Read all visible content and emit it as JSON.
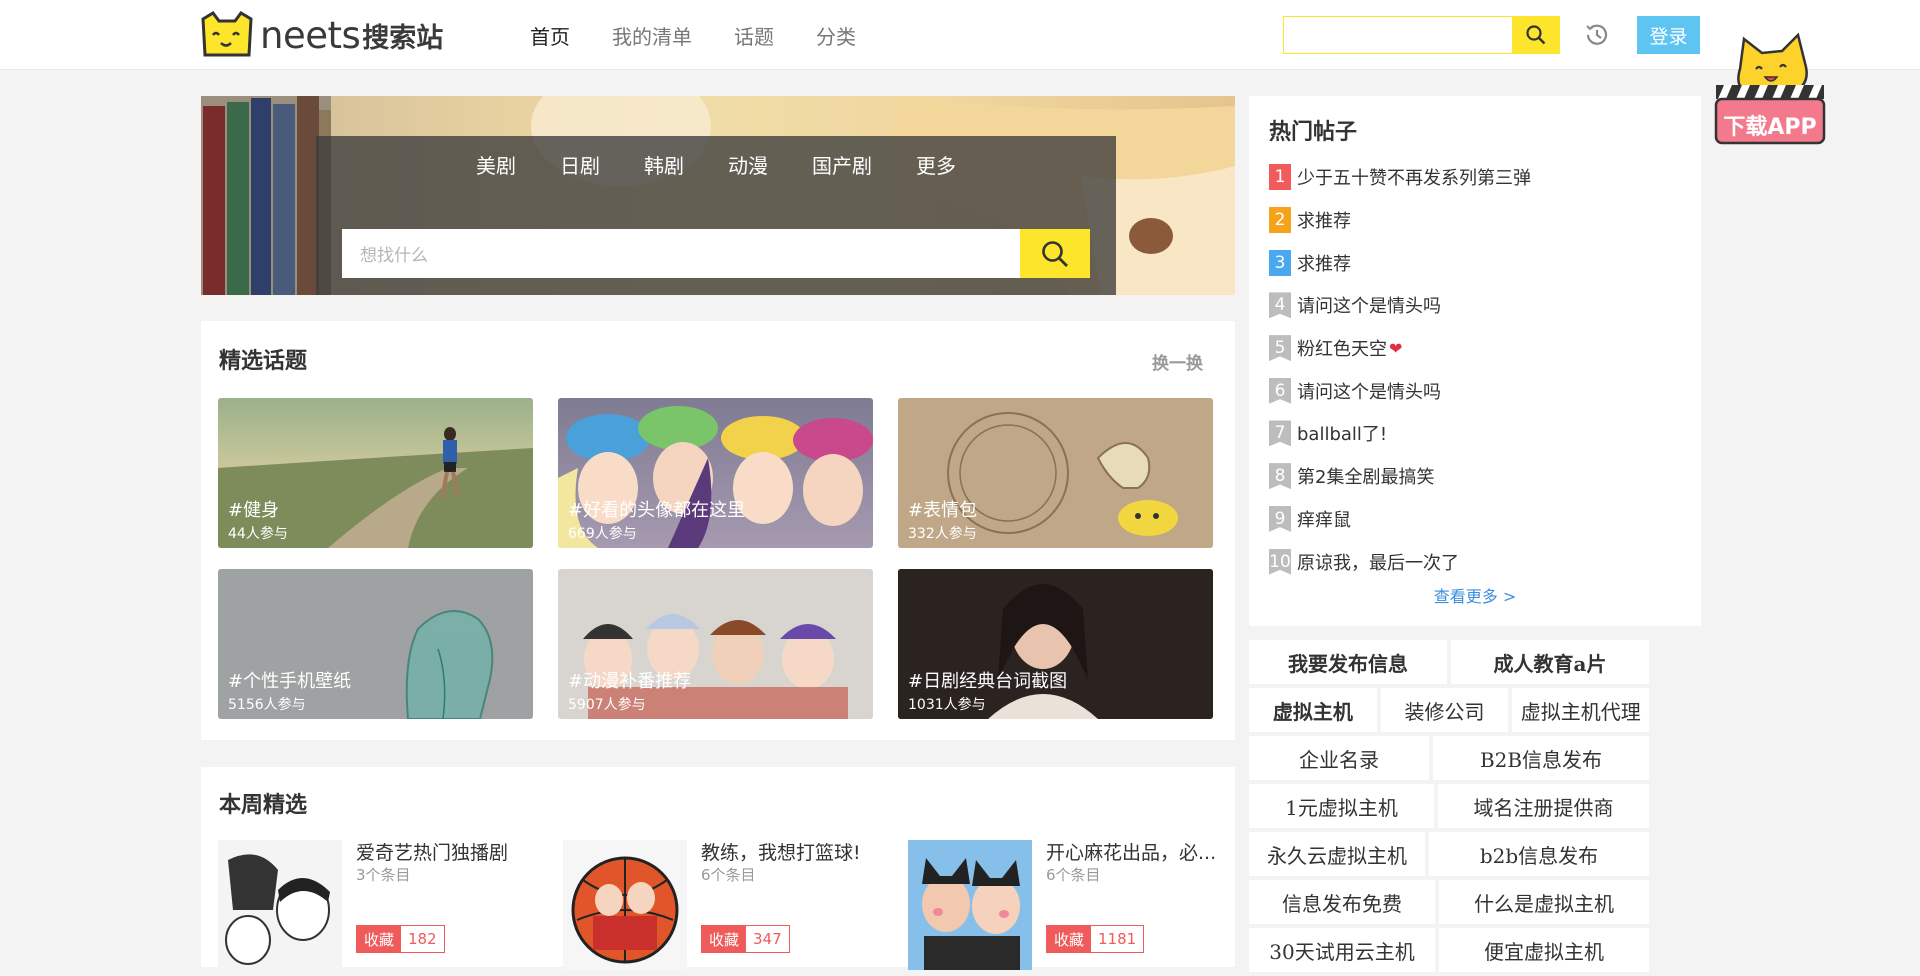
{
  "header": {
    "logo_text": "neets",
    "logo_sub": "搜索站",
    "nav": [
      "首页",
      "我的清单",
      "话题",
      "分类"
    ],
    "search_value": "",
    "login_label": "登录",
    "app_badge_label": "下载APP"
  },
  "banner": {
    "tabs": [
      "美剧",
      "日剧",
      "韩剧",
      "动漫",
      "国产剧",
      "更多"
    ],
    "search_placeholder": "想找什么"
  },
  "topics": {
    "title": "精选话题",
    "refresh_label": "换一换",
    "items": [
      {
        "name": "#健身",
        "count": "44人参与"
      },
      {
        "name": "#好看的头像都在这里",
        "count": "669人参与"
      },
      {
        "name": "#表情包",
        "count": "332人参与"
      },
      {
        "name": "#个性手机壁纸",
        "count": "5156人参与"
      },
      {
        "name": "#动漫补番推荐",
        "count": "5907人参与"
      },
      {
        "name": "#日剧经典台词截图",
        "count": "1031人参与"
      }
    ]
  },
  "weekly": {
    "title": "本周精选",
    "items": [
      {
        "name": "爱奇艺热门独播剧",
        "count": "3个条目",
        "fav_label": "收藏",
        "fav_count": "182"
      },
      {
        "name": "教练，我想打篮球!",
        "count": "6个条目",
        "fav_label": "收藏",
        "fav_count": "347"
      },
      {
        "name": "开心麻花出品，必...",
        "count": "6个条目",
        "fav_label": "收藏",
        "fav_count": "1181"
      }
    ]
  },
  "hot": {
    "title": "热门帖子",
    "items": [
      {
        "rank": "1",
        "text": "少于五十赞不再发系列第三弹",
        "color": "#f15b5b"
      },
      {
        "rank": "2",
        "text": "求推荐",
        "color": "#f7a21b"
      },
      {
        "rank": "3",
        "text": "求推荐",
        "color": "#4aa8f0"
      },
      {
        "rank": "4",
        "text": "请问这个是情头吗",
        "color": "#bdbdbd"
      },
      {
        "rank": "5",
        "text": "粉红色天空",
        "color": "#bdbdbd"
      },
      {
        "rank": "6",
        "text": "请问这个是情头吗",
        "color": "#bdbdbd"
      },
      {
        "rank": "7",
        "text": "ballball了!",
        "color": "#bdbdbd"
      },
      {
        "rank": "8",
        "text": "第2集全剧最搞笑",
        "color": "#bdbdbd"
      },
      {
        "rank": "9",
        "text": "痒痒鼠",
        "color": "#bdbdbd"
      },
      {
        "rank": "10",
        "text": "原谅我，最后一次了",
        "color": "#bdbdbd"
      }
    ],
    "more_label": "查看更多 >"
  },
  "keywords": [
    [
      {
        "t": "我要发布信息",
        "b": true
      },
      {
        "t": "成人教育a片",
        "b": true
      }
    ],
    [
      {
        "t": "虚拟主机",
        "b": true
      },
      {
        "t": "装修公司",
        "b": false
      },
      {
        "t": "虚拟主机代理",
        "b": false
      }
    ],
    [
      {
        "t": "企业名录",
        "b": false
      },
      {
        "t": "B2B信息发布",
        "b": false
      }
    ],
    [
      {
        "t": "1元虚拟主机",
        "b": false
      },
      {
        "t": "域名注册提供商",
        "b": false
      }
    ],
    [
      {
        "t": "永久云虚拟主机",
        "b": false
      },
      {
        "t": "b2b信息发布",
        "b": false
      }
    ],
    [
      {
        "t": "信息发布免费",
        "b": false
      },
      {
        "t": "什么是虚拟主机",
        "b": false
      }
    ],
    [
      {
        "t": "30天试用云主机",
        "b": false
      },
      {
        "t": "便宜虚拟主机",
        "b": false
      }
    ]
  ]
}
